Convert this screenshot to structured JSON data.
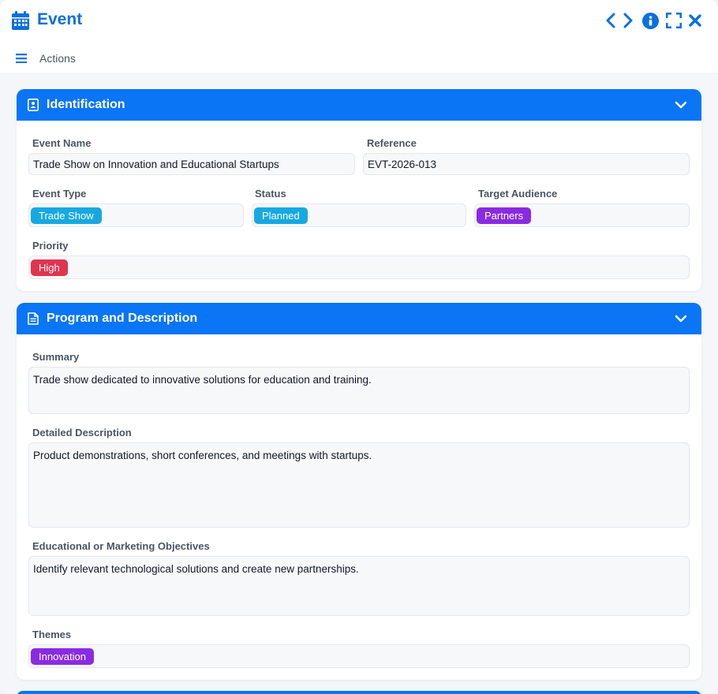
{
  "window": {
    "title": "Event",
    "actions_label": "Actions",
    "icons": [
      "calendar-icon",
      "chevron-left-icon",
      "chevron-right-icon",
      "info-icon",
      "fullscreen-icon",
      "close-icon",
      "menu-icon"
    ]
  },
  "identification": {
    "title": "Identification",
    "event_name": {
      "label": "Event Name",
      "value": "Trade Show on Innovation and Educational Startups"
    },
    "reference": {
      "label": "Reference",
      "value": "EVT-2026-013"
    },
    "event_type": {
      "label": "Event Type",
      "value": "Trade Show",
      "color": "#16a9e1"
    },
    "status": {
      "label": "Status",
      "value": "Planned",
      "color": "#16a9e1"
    },
    "target_audience": {
      "label": "Target Audience",
      "value": "Partners",
      "color": "#8a2be2"
    },
    "priority": {
      "label": "Priority",
      "value": "High",
      "color": "#e0344f"
    }
  },
  "program": {
    "title": "Program and Description",
    "summary": {
      "label": "Summary",
      "value": "Trade show dedicated to innovative solutions for education and training."
    },
    "detailed_description": {
      "label": "Detailed Description",
      "value": "Product demonstrations, short conferences, and meetings with startups."
    },
    "objectives": {
      "label": "Educational or Marketing Objectives",
      "value": "Identify relevant technological solutions and create new partnerships."
    },
    "themes": {
      "label": "Themes",
      "value": "Innovation",
      "color": "#8a2be2"
    }
  },
  "colors": {
    "accent": "#0a75f5",
    "title": "#0b6fe0"
  }
}
